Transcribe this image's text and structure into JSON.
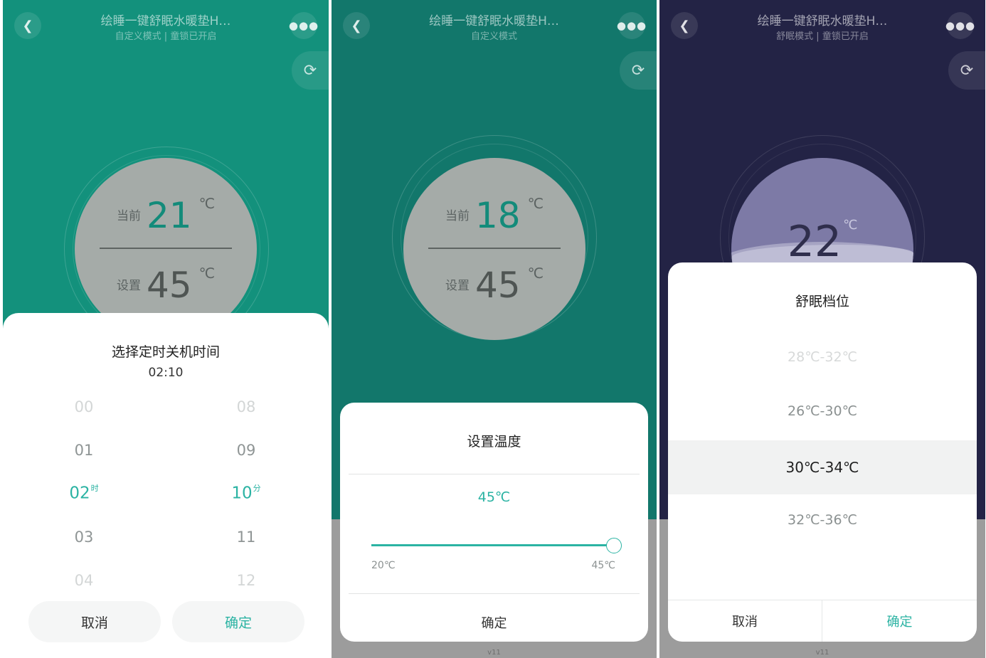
{
  "screens": [
    {
      "nav": {
        "title": "绘睡一键舒眠水暖垫H…",
        "subtitle": "自定义模式 | 童锁已开启"
      },
      "dial": {
        "current_label": "当前",
        "current_value": "21",
        "set_label": "设置",
        "set_value": "45",
        "unit": "℃"
      },
      "timer_sheet": {
        "title": "选择定时关机时间",
        "time": "02:10",
        "hours": [
          "00",
          "01",
          "02",
          "03",
          "04"
        ],
        "hour_unit": "时",
        "minutes": [
          "08",
          "09",
          "10",
          "11",
          "12"
        ],
        "minute_unit": "分",
        "cancel": "取消",
        "confirm": "确定"
      }
    },
    {
      "nav": {
        "title": "绘睡一键舒眠水暖垫H…",
        "subtitle": "自定义模式"
      },
      "dial": {
        "current_label": "当前",
        "current_value": "18",
        "set_label": "设置",
        "set_value": "45",
        "unit": "℃"
      },
      "temp_sheet": {
        "title": "设置温度",
        "value": "45℃",
        "min": "20℃",
        "max": "45℃",
        "slider_fraction": 1.0,
        "confirm": "确定"
      },
      "version": "v11"
    },
    {
      "nav": {
        "title": "绘睡一键舒眠水暖垫H…",
        "subtitle": "舒眠模式 | 童锁已开启"
      },
      "dial": {
        "value": "22",
        "unit": "℃"
      },
      "level_sheet": {
        "title": "舒眠档位",
        "options": [
          "28℃-32℃",
          "26℃-30℃",
          "30℃-34℃",
          "32℃-36℃"
        ],
        "selected_index": 2,
        "cancel": "取消",
        "confirm": "确定"
      },
      "version": "v11"
    }
  ],
  "icons": {
    "back": "chevron-left-icon",
    "more": "more-dots-icon",
    "refresh": "refresh-icon"
  },
  "colors": {
    "teal_bg": "#13917c",
    "teal_dark_bg": "#12776b",
    "navy_bg": "#232345",
    "accent": "#2bb3a3"
  }
}
